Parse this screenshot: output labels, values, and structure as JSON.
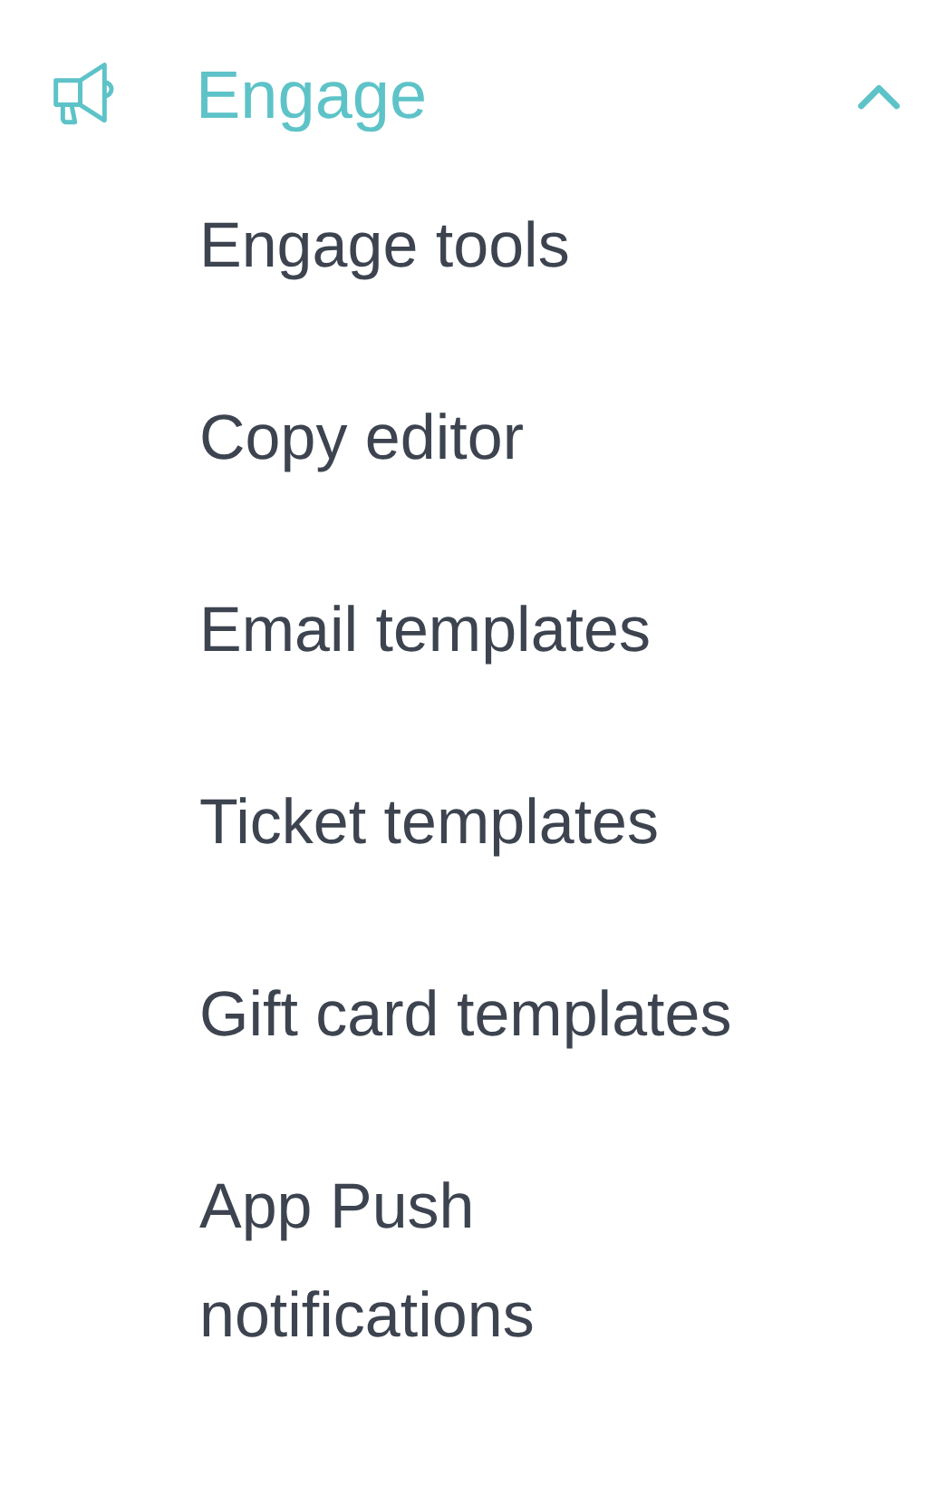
{
  "nav_group": {
    "label": "Engage",
    "expanded": true,
    "items": [
      {
        "label": "Engage tools"
      },
      {
        "label": "Copy editor"
      },
      {
        "label": "Email templates"
      },
      {
        "label": "Ticket templates"
      },
      {
        "label": "Gift card templates"
      },
      {
        "label": "App Push notifications"
      }
    ]
  }
}
